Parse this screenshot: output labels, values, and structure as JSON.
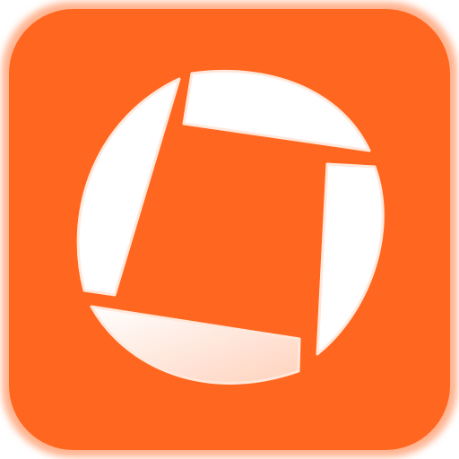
{
  "icon": {
    "name": "app-icon",
    "glyph": "scanner-aperture-icon",
    "colors": {
      "background": "#ff6720",
      "background_edge": "#ffb38f",
      "glyph_fill": "#ffffff",
      "glyph_shade": "#ffd2bd",
      "glyph_outline": "#ffe8db"
    }
  }
}
